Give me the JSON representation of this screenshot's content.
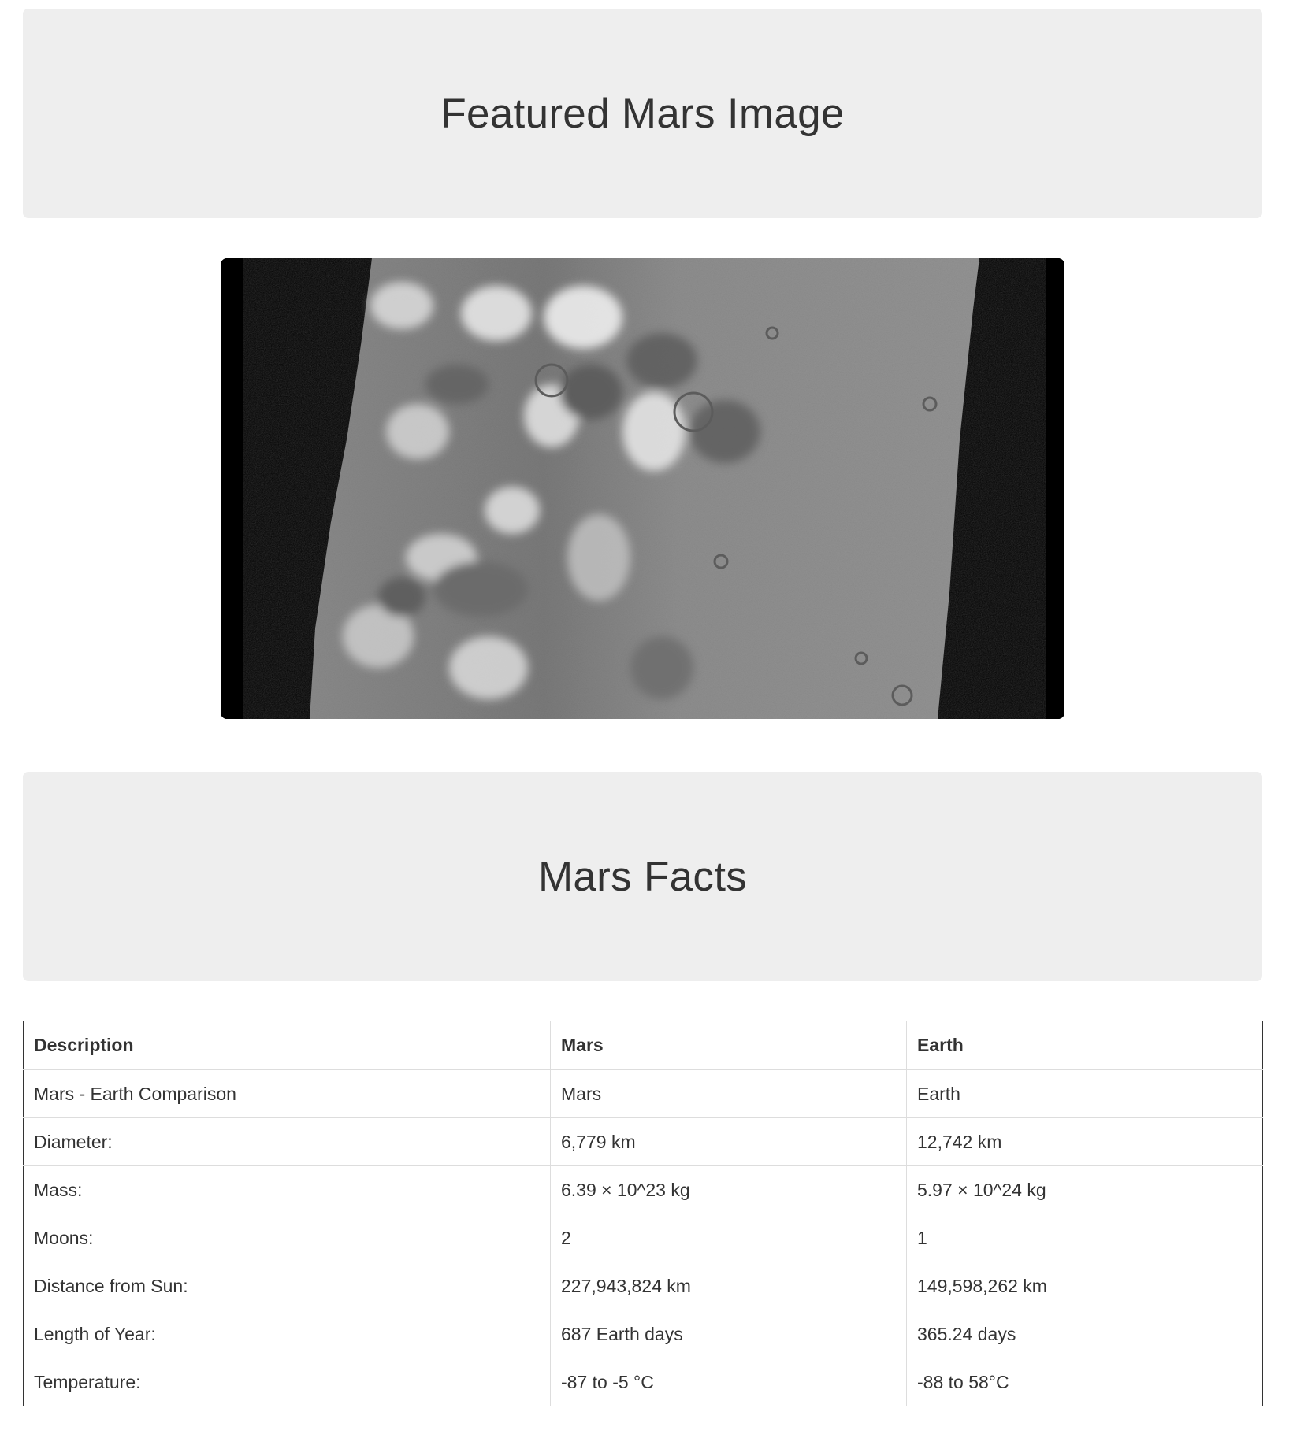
{
  "featured": {
    "heading": "Featured Mars Image",
    "image_alt": "Featured Mars Image"
  },
  "facts": {
    "heading": "Mars Facts",
    "columns": [
      "Description",
      "Mars",
      "Earth"
    ],
    "rows": [
      [
        "Mars - Earth Comparison",
        "Mars",
        "Earth"
      ],
      [
        "Diameter:",
        "6,779 km",
        "12,742 km"
      ],
      [
        "Mass:",
        "6.39 × 10^23 kg",
        "5.97 × 10^24 kg"
      ],
      [
        "Moons:",
        "2",
        "1"
      ],
      [
        "Distance from Sun:",
        "227,943,824 km",
        "149,598,262 km"
      ],
      [
        "Length of Year:",
        "687 Earth days",
        "365.24 days"
      ],
      [
        "Temperature:",
        "-87 to -5 °C",
        "-88 to 58°C"
      ]
    ]
  }
}
